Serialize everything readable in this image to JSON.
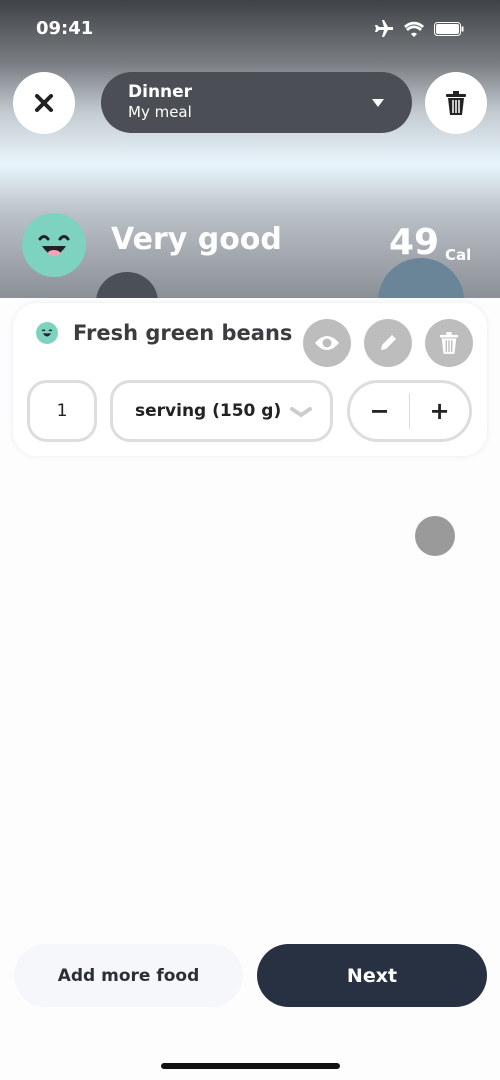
{
  "status": {
    "time": "09:41"
  },
  "header": {
    "meal_title": "Dinner",
    "meal_subtitle": "My meal"
  },
  "summary": {
    "rating": "Very good",
    "calories": "49",
    "calories_unit": "Cal"
  },
  "food": {
    "name": "Fresh green beans",
    "quantity": "1",
    "unit": "serving (150 g)",
    "minus": "−",
    "plus": "+"
  },
  "footer": {
    "add_more": "Add more food",
    "next": "Next"
  },
  "colors": {
    "accent": "#7dd3c0",
    "primary": "#283142"
  }
}
